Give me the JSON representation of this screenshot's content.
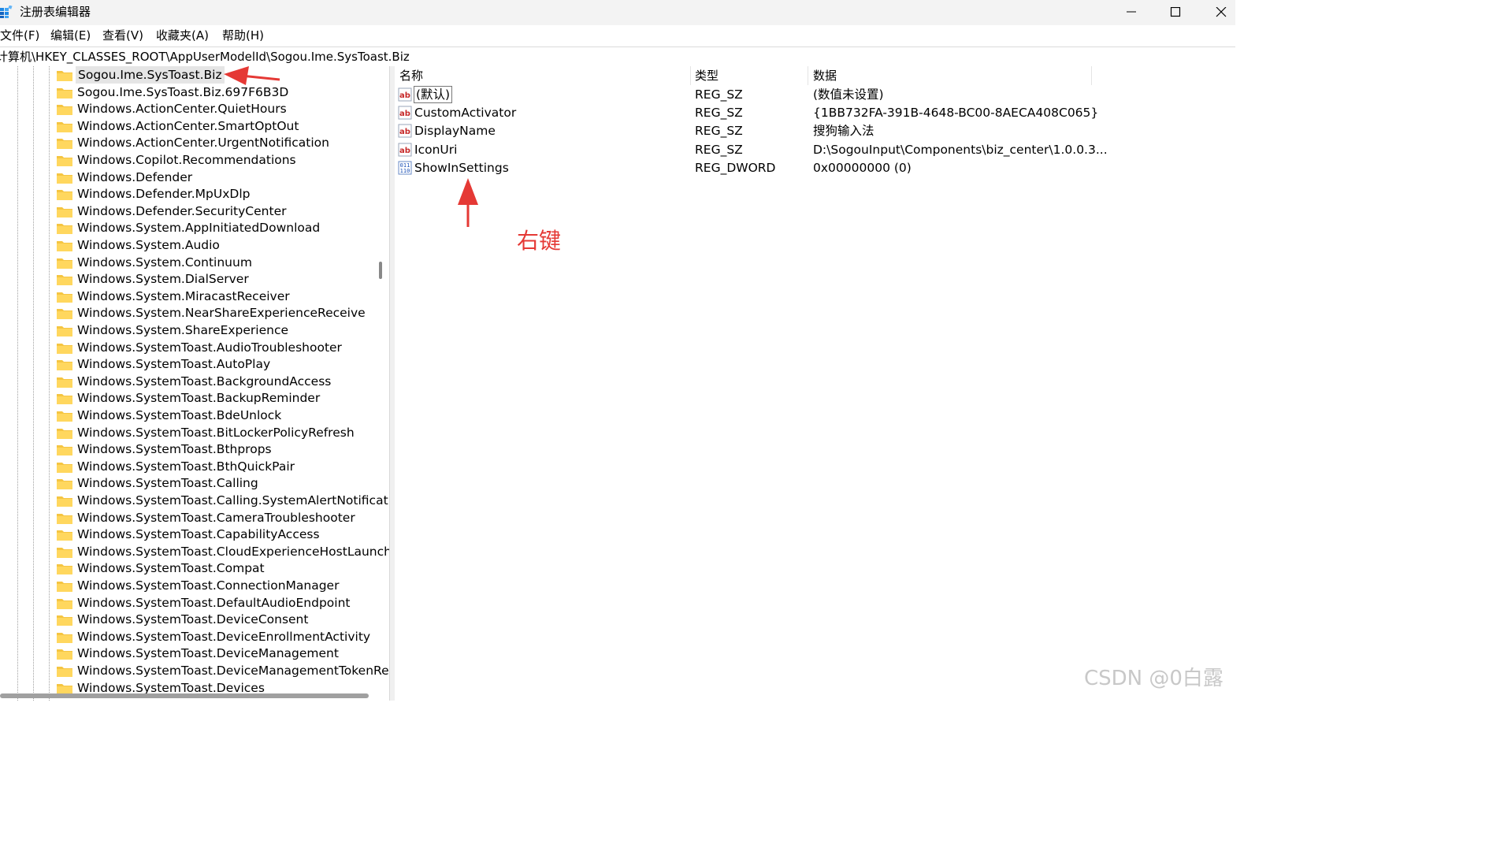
{
  "window": {
    "title": "注册表编辑器",
    "app_icon": "regedit-icon",
    "controls": [
      "minimize-icon",
      "maximize-icon",
      "close-icon"
    ]
  },
  "menu": [
    "文件(F)",
    "编辑(E)",
    "查看(V)",
    "收藏夹(A)",
    "帮助(H)"
  ],
  "address": "计算机\\HKEY_CLASSES_ROOT\\AppUserModelId\\Sogou.Ime.SysToast.Biz",
  "tree": {
    "items": [
      "Sogou.Ime.SysToast.Biz",
      "Sogou.Ime.SysToast.Biz.697F6B3D",
      "Windows.ActionCenter.QuietHours",
      "Windows.ActionCenter.SmartOptOut",
      "Windows.ActionCenter.UrgentNotification",
      "Windows.Copilot.Recommendations",
      "Windows.Defender",
      "Windows.Defender.MpUxDlp",
      "Windows.Defender.SecurityCenter",
      "Windows.System.AppInitiatedDownload",
      "Windows.System.Audio",
      "Windows.System.Continuum",
      "Windows.System.DialServer",
      "Windows.System.MiracastReceiver",
      "Windows.System.NearShareExperienceReceive",
      "Windows.System.ShareExperience",
      "Windows.SystemToast.AudioTroubleshooter",
      "Windows.SystemToast.AutoPlay",
      "Windows.SystemToast.BackgroundAccess",
      "Windows.SystemToast.BackupReminder",
      "Windows.SystemToast.BdeUnlock",
      "Windows.SystemToast.BitLockerPolicyRefresh",
      "Windows.SystemToast.Bthprops",
      "Windows.SystemToast.BthQuickPair",
      "Windows.SystemToast.Calling",
      "Windows.SystemToast.Calling.SystemAlertNotificatio",
      "Windows.SystemToast.CameraTroubleshooter",
      "Windows.SystemToast.CapabilityAccess",
      "Windows.SystemToast.CloudExperienceHostLauncher",
      "Windows.SystemToast.Compat",
      "Windows.SystemToast.ConnectionManager",
      "Windows.SystemToast.DefaultAudioEndpoint",
      "Windows.SystemToast.DeviceConsent",
      "Windows.SystemToast.DeviceEnrollmentActivity",
      "Windows.SystemToast.DeviceManagement",
      "Windows.SystemToast.DeviceManagementTokenRen",
      "Windows.SystemToast.Devices"
    ],
    "selected_index": 0,
    "folder_color": "#f5c542"
  },
  "list": {
    "columns": {
      "name": "名称",
      "type": "类型",
      "data": "数据"
    },
    "rows": [
      {
        "icon": "string-value-icon",
        "name": "(默认)",
        "type": "REG_SZ",
        "data": "(数值未设置)"
      },
      {
        "icon": "string-value-icon",
        "name": "CustomActivator",
        "type": "REG_SZ",
        "data": "{1BB732FA-391B-4648-BC00-8AECA408C065}"
      },
      {
        "icon": "string-value-icon",
        "name": "DisplayName",
        "type": "REG_SZ",
        "data": "搜狗输入法"
      },
      {
        "icon": "string-value-icon",
        "name": "IconUri",
        "type": "REG_SZ",
        "data": "D:\\SogouInput\\Components\\biz_center\\1.0.0.3..."
      },
      {
        "icon": "binary-value-icon",
        "name": "ShowInSettings",
        "type": "REG_DWORD",
        "data": "0x00000000 (0)"
      }
    ]
  },
  "annotation": {
    "text": "右键",
    "color": "#e53935"
  },
  "watermark": "CSDN @0白露"
}
